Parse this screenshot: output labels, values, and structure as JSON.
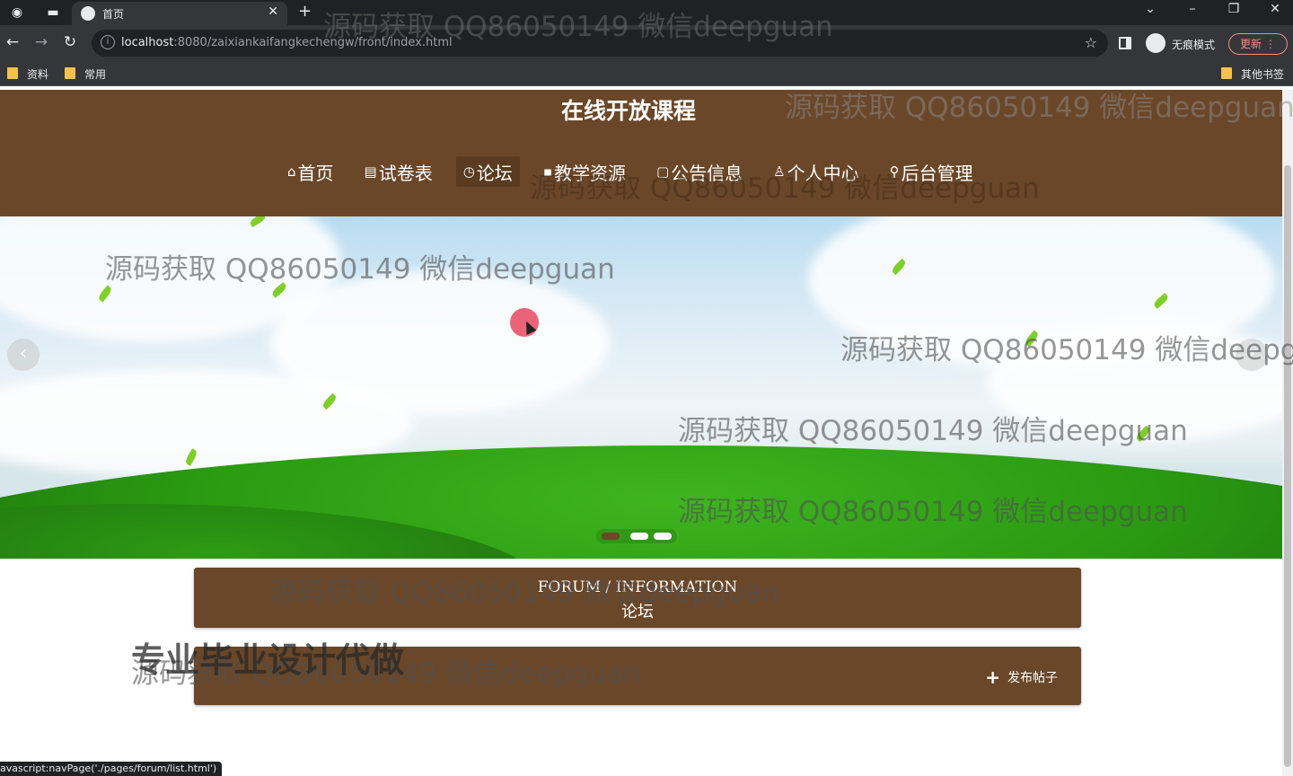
{
  "browser": {
    "tab_title": "首页",
    "tab_close": "✕",
    "new_tab": "+",
    "url_host": "localhost",
    "url_rest": ":8080/zaixiankaifangkechengw/front/index.html",
    "incognito_label": "无痕模式",
    "update_label": "更新",
    "bookmarks": [
      "资料",
      "常用"
    ],
    "other_bookmarks": "其他书签",
    "status_url": "avascript:navPage('./pages/forum/list.html')"
  },
  "site": {
    "title": "在线开放课程",
    "nav": [
      {
        "icon": "⌂",
        "label": "首页"
      },
      {
        "icon": "▤",
        "label": "试卷表"
      },
      {
        "icon": "◷",
        "label": "论坛"
      },
      {
        "icon": "▪",
        "label": "教学资源"
      },
      {
        "icon": "▢",
        "label": "公告信息"
      },
      {
        "icon": "♙",
        "label": "个人中心"
      },
      {
        "icon": "⚲",
        "label": "后台管理"
      }
    ],
    "active_nav_index": 2
  },
  "banner": {
    "prev": "‹",
    "next": "›",
    "slide_count": 3,
    "active_slide": 0
  },
  "section": {
    "title_en": "FORUM / INFORMATION",
    "title_cn": "论坛",
    "post_button": "发布帖子"
  },
  "overlay": {
    "watermark": "源码获取 QQ86050149 微信deepguan",
    "promo": "专业毕业设计代做"
  },
  "colors": {
    "brand_brown": "#6a4729",
    "active_nav": "#5a3b20",
    "update_red": "#f28b82"
  }
}
